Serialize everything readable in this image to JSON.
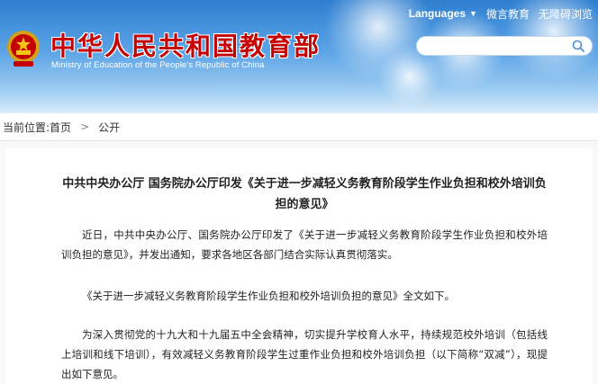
{
  "header": {
    "site_title": "中华人民共和国教育部",
    "site_subtitle": "Ministry of Education of the People's Republic of China",
    "languages_label": "Languages",
    "weiyan_label": "微言教育",
    "accessible_label": "无障碍浏览",
    "search_placeholder": ""
  },
  "breadcrumb": {
    "prefix": "当前位置:",
    "home": "首页",
    "separator": ">",
    "current": "公开"
  },
  "article": {
    "title": "中共中央办公厅 国务院办公厅印发《关于进一步减轻义务教育阶段学生作业负担和校外培训负担的意见》",
    "paragraphs": [
      "近日，中共中央办公厅、国务院办公厅印发了《关于进一步减轻义务教育阶段学生作业负担和校外培训负担的意见》，并发出通知，要求各地区各部门结合实际认真贯彻落实。",
      "《关于进一步减轻义务教育阶段学生作业负担和校外培训负担的意见》全文如下。",
      "为深入贯彻党的十九大和十九届五中全会精神，切实提升学校育人水平，持续规范校外培训（包括线上培训和线下培训），有效减轻义务教育阶段学生过重作业负担和校外培训负担（以下简称“双减”），现提出如下意见。"
    ]
  },
  "colors": {
    "title_red": "#c40000",
    "header_blue": "#2f7fd0"
  },
  "icons": {
    "emblem": "national-emblem-icon",
    "search": "search-icon",
    "dropdown": "caret-down-icon"
  }
}
